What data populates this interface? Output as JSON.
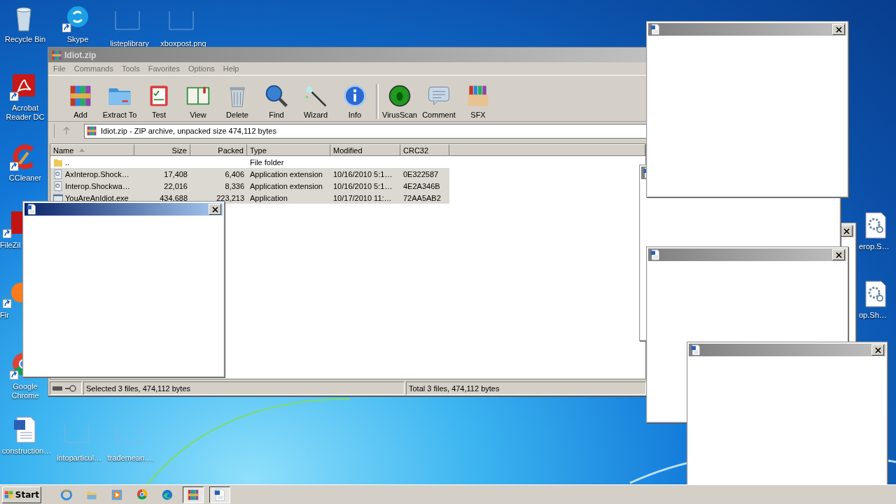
{
  "desktop_icons": [
    {
      "label": "Recycle Bin",
      "kind": "recycle"
    },
    {
      "label": "Skype",
      "kind": "chat"
    },
    {
      "label": "listeplibrary",
      "kind": "frame"
    },
    {
      "label": "xboxpost.png",
      "kind": "frame"
    },
    {
      "label": "Acrobat Reader DC",
      "kind": "acrobat"
    },
    {
      "label": "CCleaner",
      "kind": "cleaner"
    },
    {
      "label": "FileZil",
      "kind": "filezilla"
    },
    {
      "label": "Fir",
      "kind": "firefox"
    },
    {
      "label": "Google Chrome",
      "kind": "chrome"
    },
    {
      "label": "construction…",
      "kind": "word"
    },
    {
      "label": "intoparticul…",
      "kind": "frame"
    },
    {
      "label": "trademean….",
      "kind": "frame"
    },
    {
      "label": "erop.S…",
      "kind": "gear"
    },
    {
      "label": "op.Sh…",
      "kind": "gear"
    }
  ],
  "archiver": {
    "title": "Idiot.zip",
    "menu": [
      "File",
      "Commands",
      "Tools",
      "Favorites",
      "Options",
      "Help"
    ],
    "toolbar": [
      {
        "label": "Add",
        "kind": "books"
      },
      {
        "label": "Extract To",
        "kind": "folder"
      },
      {
        "label": "Test",
        "kind": "clipboard"
      },
      {
        "label": "View",
        "kind": "book"
      },
      {
        "label": "Delete",
        "kind": "trash"
      },
      {
        "label": "Find",
        "kind": "magnifier"
      },
      {
        "label": "Wizard",
        "kind": "wand"
      },
      {
        "label": "Info",
        "kind": "info"
      },
      {
        "label": "VirusScan",
        "kind": "bug"
      },
      {
        "label": "Comment",
        "kind": "comment"
      },
      {
        "label": "SFX",
        "kind": "box"
      }
    ],
    "address": "Idiot.zip - ZIP archive, unpacked size 474,112 bytes",
    "columns": [
      "Name",
      "Size",
      "Packed",
      "Type",
      "Modified",
      "CRC32"
    ],
    "rows": [
      {
        "name": "..",
        "size": "",
        "packed": "",
        "type": "File folder",
        "modified": "",
        "crc": "",
        "kind": "folder",
        "selected": false
      },
      {
        "name": "AxInterop.Shock…",
        "size": "17,408",
        "packed": "6,406",
        "type": "Application extension",
        "modified": "10/16/2010 5:1…",
        "crc": "0E322587",
        "kind": "dll",
        "selected": true
      },
      {
        "name": "Interop.Shockwa…",
        "size": "22,016",
        "packed": "8,336",
        "type": "Application extension",
        "modified": "10/16/2010 5:1…",
        "crc": "4E2A346B",
        "kind": "dll",
        "selected": true
      },
      {
        "name": "YouAreAnIdiot.exe",
        "size": "434,688",
        "packed": "223,213",
        "type": "Application",
        "modified": "10/17/2010 11:…",
        "crc": "72AA5AB2",
        "kind": "exe",
        "selected": true
      }
    ],
    "status_selected": "Selected 3 files, 474,112 bytes",
    "status_total": "Total 3 files, 474,112 bytes"
  },
  "popups": [
    {
      "active": false
    },
    {
      "active": false
    },
    {
      "active": false
    },
    {
      "active": false
    },
    {
      "active": false
    },
    {
      "active": true
    }
  ],
  "taskbar": {
    "start": "Start",
    "items": [
      {
        "kind": "ie",
        "pressed": false
      },
      {
        "kind": "explorer",
        "pressed": false
      },
      {
        "kind": "media",
        "pressed": false
      },
      {
        "kind": "chrome",
        "pressed": false
      },
      {
        "kind": "edge",
        "pressed": false
      },
      {
        "kind": "books",
        "pressed": true
      },
      {
        "kind": "word",
        "pressed": true
      }
    ]
  }
}
